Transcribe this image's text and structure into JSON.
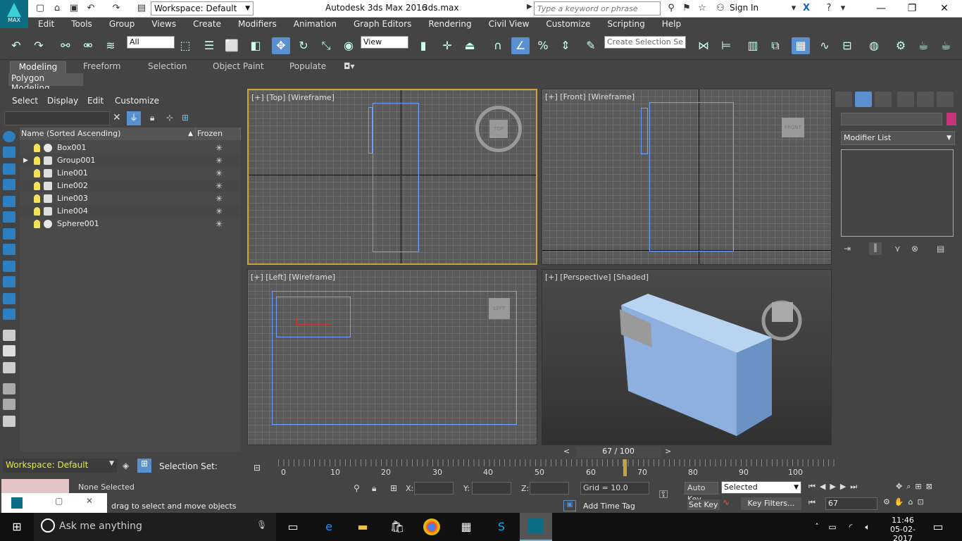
{
  "title_bar": {
    "workspace": "Workspace: Default",
    "app_title": "Autodesk 3ds Max 2016",
    "file_name": "3ds.max",
    "search_placeholder": "Type a keyword or phrase",
    "sign_in": "Sign In",
    "logo_text": "MAX"
  },
  "menu": [
    "Edit",
    "Tools",
    "Group",
    "Views",
    "Create",
    "Modifiers",
    "Animation",
    "Graph Editors",
    "Rendering",
    "Civil View",
    "Customize",
    "Scripting",
    "Help"
  ],
  "toolbar": {
    "filter_value": "All",
    "coord_value": "View",
    "selection_set_placeholder": "Create Selection Se"
  },
  "ribbon": {
    "tabs": [
      "Modeling",
      "Freeform",
      "Selection",
      "Object Paint",
      "Populate"
    ],
    "panel_title": "Polygon Modeling"
  },
  "explorer": {
    "menus": [
      "Select",
      "Display",
      "Edit",
      "Customize"
    ],
    "col_name": "Name (Sorted Ascending)",
    "col_frozen": "Frozen",
    "rows": [
      {
        "name": "Box001"
      },
      {
        "name": "Group001"
      },
      {
        "name": "Line001"
      },
      {
        "name": "Line002"
      },
      {
        "name": "Line003"
      },
      {
        "name": "Line004"
      },
      {
        "name": "Sphere001"
      }
    ],
    "workspace": "Workspace: Default",
    "selection_set": "Selection Set:"
  },
  "viewports": {
    "top": "[+] [Top] [Wireframe]",
    "front": "[+] [Front] [Wireframe]",
    "left": "[+] [Left] [Wireframe]",
    "persp": "[+] [Perspective] [Shaded]",
    "cube_top": "TOP",
    "cube_front": "FRONT",
    "cube_left": "LEFT"
  },
  "command_panel": {
    "modifier_list": "Modifier List"
  },
  "timeline": {
    "frame_label": "67 / 100",
    "ticks": [
      "0",
      "10",
      "20",
      "30",
      "40",
      "50",
      "60",
      "70",
      "80",
      "90",
      "100"
    ],
    "current_frame": 67
  },
  "status": {
    "selection": "None Selected",
    "prompt": "drag to select and move objects",
    "x_label": "X:",
    "y_label": "Y:",
    "z_label": "Z:",
    "grid": "Grid = 10.0",
    "add_time_tag": "Add Time Tag",
    "auto_key": "Auto Key",
    "set_key": "Set Key",
    "key_mode": "Selected",
    "key_filters": "Key Filters...",
    "frame_value": "67"
  },
  "taskbar": {
    "cortana": "Ask me anything",
    "time": "11:46",
    "date": "05-02-2017"
  }
}
